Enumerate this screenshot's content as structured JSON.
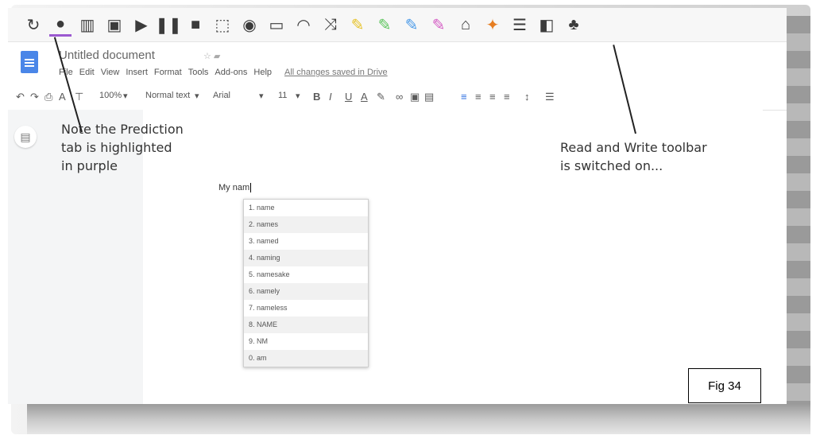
{
  "toolbar": {
    "buttons": [
      {
        "name": "check-it-icon",
        "glyph": "↻",
        "active": false
      },
      {
        "name": "prediction-icon",
        "glyph": "●",
        "active": true
      },
      {
        "name": "dictionary-icon",
        "glyph": "▥",
        "active": false
      },
      {
        "name": "picture-dictionary-icon",
        "glyph": "▣",
        "active": false
      },
      {
        "name": "play-icon",
        "glyph": "▶",
        "active": false
      },
      {
        "name": "pause-icon",
        "glyph": "❚❚",
        "active": false
      },
      {
        "name": "stop-icon",
        "glyph": "■",
        "active": false
      },
      {
        "name": "screenshot-reader-icon",
        "glyph": "⬚",
        "active": false
      },
      {
        "name": "audio-maker-icon",
        "glyph": "◉",
        "active": false
      },
      {
        "name": "screen-mask-icon",
        "glyph": "▭",
        "active": false
      },
      {
        "name": "talk-type-icon",
        "glyph": "◠",
        "active": false
      },
      {
        "name": "translator-icon",
        "glyph": "⤨",
        "active": false
      },
      {
        "name": "highlight-yellow-icon",
        "glyph": "✎",
        "active": false,
        "color": "#e6c229"
      },
      {
        "name": "highlight-green-icon",
        "glyph": "✎",
        "active": false,
        "color": "#5cc45c"
      },
      {
        "name": "highlight-blue-icon",
        "glyph": "✎",
        "active": false,
        "color": "#4a9ae8"
      },
      {
        "name": "highlight-pink-icon",
        "glyph": "✎",
        "active": false,
        "color": "#d45cc4"
      },
      {
        "name": "clear-highlights-icon",
        "glyph": "⌂",
        "active": false
      },
      {
        "name": "collect-highlights-icon",
        "glyph": "✦",
        "active": false,
        "color": "#e67e22"
      },
      {
        "name": "vocabulary-list-icon",
        "glyph": "☰",
        "active": false
      },
      {
        "name": "voice-note-icon",
        "glyph": "◧",
        "active": false
      },
      {
        "name": "simplify-icon",
        "glyph": "♣",
        "active": false
      }
    ],
    "active_color": "#9b59d0"
  },
  "document": {
    "title": "Untitled document",
    "menus": [
      "File",
      "Edit",
      "View",
      "Insert",
      "Format",
      "Tools",
      "Add-ons",
      "Help"
    ],
    "saved_status": "All changes saved in Drive",
    "zoom": "100%",
    "style": "Normal text",
    "font": "Arial",
    "font_size": "11",
    "typed_text": "My nam"
  },
  "prediction": {
    "items": [
      "1. name",
      "2. names",
      "3. named",
      "4. naming",
      "5. namesake",
      "6. namely",
      "7. nameless",
      "8. NAME",
      "9. NM",
      "0. am"
    ]
  },
  "annotations": {
    "note_prediction": "Note the Prediction\ntab is highlighted\nin purple",
    "note_toolbar": "Read and Write toolbar\nis switched on...",
    "figure_label": "Fig 34"
  }
}
